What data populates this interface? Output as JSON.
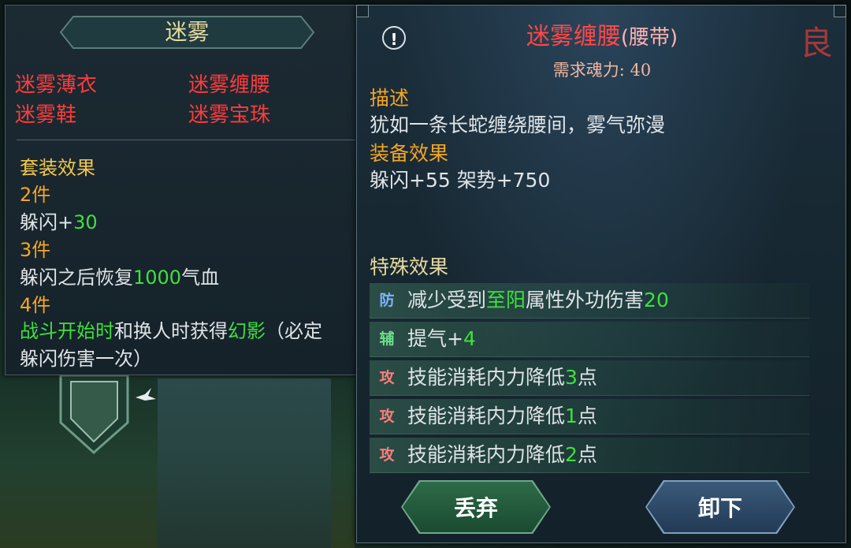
{
  "set_panel": {
    "title": "迷雾",
    "pieces": [
      "迷雾薄衣",
      "迷雾缠腰",
      "迷雾鞋",
      "迷雾宝珠"
    ],
    "bonus_heading": "套装效果",
    "tiers": [
      {
        "count": "2件",
        "lines": [
          [
            {
              "t": "躲闪+",
              "c": "white"
            },
            {
              "t": "30",
              "c": "green"
            }
          ]
        ]
      },
      {
        "count": "3件",
        "lines": [
          [
            {
              "t": "躲闪之后恢复",
              "c": "white"
            },
            {
              "t": "1000",
              "c": "green"
            },
            {
              "t": "气血",
              "c": "white"
            }
          ]
        ]
      },
      {
        "count": "4件",
        "lines": [
          [
            {
              "t": "战斗开始时",
              "c": "green"
            },
            {
              "t": "和换人时获得",
              "c": "white"
            },
            {
              "t": "幻影",
              "c": "green"
            },
            {
              "t": "（必定",
              "c": "white"
            }
          ],
          [
            {
              "t": "躲闪伤害一次）",
              "c": "white"
            }
          ]
        ]
      }
    ]
  },
  "item_panel": {
    "name": "迷雾缠腰",
    "type": "(腰带)",
    "grade": "良",
    "alert_icon": "!",
    "requirement": "需求魂力: 40",
    "description_heading": "描述",
    "description": "犹如一条长蛇缠绕腰间，雾气弥漫",
    "equip_heading": "装备效果",
    "equip_stats": "躲闪+55  架势+750",
    "special_heading": "特殊效果",
    "special_effects": [
      {
        "tag": "防",
        "kind": "def",
        "parts": [
          {
            "t": "减少受到",
            "c": "white"
          },
          {
            "t": "至阳",
            "c": "green"
          },
          {
            "t": "属性外功伤害",
            "c": "white"
          },
          {
            "t": "20",
            "c": "green"
          }
        ]
      },
      {
        "tag": "辅",
        "kind": "aux",
        "parts": [
          {
            "t": "提气+",
            "c": "white"
          },
          {
            "t": "4",
            "c": "green"
          }
        ]
      },
      {
        "tag": "攻",
        "kind": "atk",
        "parts": [
          {
            "t": "技能消耗内力降低",
            "c": "white"
          },
          {
            "t": "3",
            "c": "green"
          },
          {
            "t": "点",
            "c": "white"
          }
        ]
      },
      {
        "tag": "攻",
        "kind": "atk",
        "parts": [
          {
            "t": "技能消耗内力降低",
            "c": "white"
          },
          {
            "t": "1",
            "c": "green"
          },
          {
            "t": "点",
            "c": "white"
          }
        ]
      },
      {
        "tag": "攻",
        "kind": "atk",
        "parts": [
          {
            "t": "技能消耗内力降低",
            "c": "white"
          },
          {
            "t": "2",
            "c": "green"
          },
          {
            "t": "点",
            "c": "white"
          }
        ]
      }
    ],
    "buttons": {
      "discard": "丢弃",
      "unequip": "卸下"
    }
  },
  "colors": {
    "legendary_red": "#ff3b3b",
    "heading_gold": "#f5a623",
    "value_green": "#3ee03e",
    "text_white": "#dfe4e6"
  }
}
